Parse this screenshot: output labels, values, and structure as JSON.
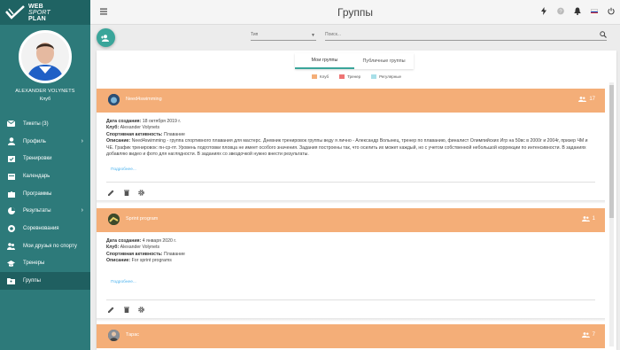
{
  "brand": {
    "line1": "WEB",
    "line2": "SPORT",
    "line3": "PLAN"
  },
  "profile": {
    "name": "ALEXANDER VOLYNETS",
    "role": "Клуб"
  },
  "sidebar": {
    "items": [
      {
        "label": "Тикеты (3)",
        "icon": "envelope-icon",
        "chevron": false
      },
      {
        "label": "Профиль",
        "icon": "person-icon",
        "chevron": true
      },
      {
        "label": "Тренировки",
        "icon": "calendar-check-icon",
        "chevron": false
      },
      {
        "label": "Календарь",
        "icon": "calendar-icon",
        "chevron": false
      },
      {
        "label": "Программы",
        "icon": "puzzle-icon",
        "chevron": false
      },
      {
        "label": "Результаты",
        "icon": "pie-chart-icon",
        "chevron": true
      },
      {
        "label": "Соревнования",
        "icon": "medal-icon",
        "chevron": false
      },
      {
        "label": "Мои друзья по спорту",
        "icon": "friends-icon",
        "chevron": false
      },
      {
        "label": "Тренеры",
        "icon": "graduation-cap-icon",
        "chevron": false
      },
      {
        "label": "Группы",
        "icon": "folder-users-icon",
        "chevron": false,
        "active": true
      }
    ]
  },
  "header": {
    "title": "Группы"
  },
  "filters": {
    "type_label": "Тип",
    "search_placeholder": "Поиск..."
  },
  "tabs": [
    {
      "label": "Мои группы",
      "active": true
    },
    {
      "label": "Публичные группы",
      "active": false
    }
  ],
  "legend": [
    {
      "label": "Клуб",
      "color": "#f4ae78"
    },
    {
      "label": "Тренер",
      "color": "#ee7474"
    },
    {
      "label": "Регулярные",
      "color": "#a8dfe8"
    }
  ],
  "groups": [
    {
      "name": "Need4swimming",
      "count": "17",
      "created_label": "Дата создания:",
      "created": "18 октября 2019 г.",
      "club_label": "Клуб:",
      "club": "Alexander Volynets",
      "activity_label": "Спортивная активность:",
      "activity": "Плавание",
      "desc_label": "Описание:",
      "description": "Need4swimming - группа спортивного плавания для мастерс. Дневник тренировок группы веду я лично - Александр Волынец, тренер по плаванию, финалист Олимпийских Игр на 50вс в 2000г и 2004г, призер ЧМ и ЧЕ. График тренировок: пн-ср-пт. Уровень подготовки пловца не имеет особого значения. Задания построены так, что осилить их может каждый, но с учетом собственной небольшой коррекции по интенсивности. В заданиях добавляю видео и фото для наглядности. В заданиях со звездочкой нужно внести результаты.",
      "more": "Подробнее..."
    },
    {
      "name": "Sprint program",
      "count": "1",
      "created_label": "Дата создания:",
      "created": "4 января 2020 г.",
      "club_label": "Клуб:",
      "club": "Alexander Volynets",
      "activity_label": "Спортивная активность:",
      "activity": "Плавание",
      "desc_label": "Описание:",
      "description": "For sprint programs",
      "more": "Подробнее..."
    },
    {
      "name": "Тарас",
      "count": "7"
    }
  ]
}
